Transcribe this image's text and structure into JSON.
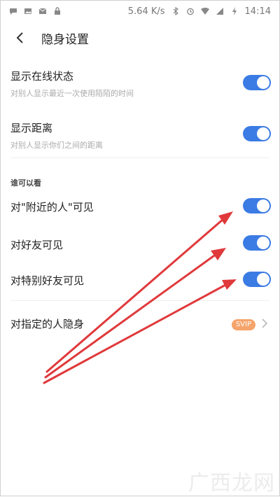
{
  "status_bar": {
    "net_speed": "5.64 K/s",
    "time": "14:14",
    "left_icons": [
      "chat-bubble-icon",
      "image-icon",
      "mail-icon",
      "lock-icon"
    ],
    "right_icons": [
      "bluetooth-icon",
      "alarm-icon",
      "wifi-icon",
      "signal-icon",
      "battery-charging-icon"
    ]
  },
  "header": {
    "title": "隐身设置",
    "back_icon": "back-chevron-icon"
  },
  "settings": [
    {
      "label": "显示在线状态",
      "sub": "对别人显示最近一次使用陌陌的时间",
      "enabled": true
    },
    {
      "label": "显示距离",
      "sub": "对别人显示你们之间的距离",
      "enabled": true
    }
  ],
  "section": {
    "label": "谁可以看"
  },
  "visibility": [
    {
      "label": "对\"附近的人\"可见",
      "enabled": true
    },
    {
      "label": "对好友可见",
      "enabled": true
    },
    {
      "label": "对特别好友可见",
      "enabled": true
    }
  ],
  "hidden_from": {
    "label": "对指定的人隐身",
    "badge": "SVIP"
  },
  "watermark": {
    "text": "广西龙网"
  },
  "colors": {
    "toggle_on": "#3b7be4",
    "badge": "#f5a46b",
    "annotation_arrow": "#e0393b"
  }
}
